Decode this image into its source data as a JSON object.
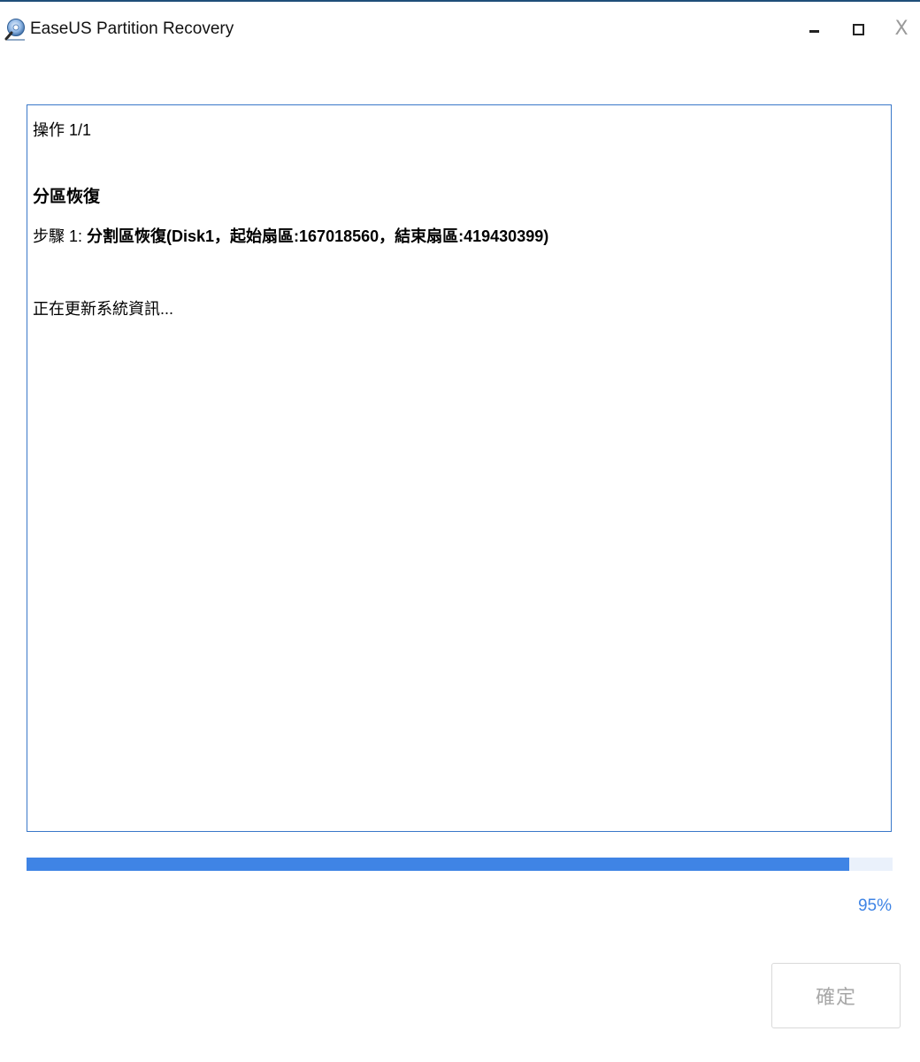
{
  "window": {
    "title": "EaseUS Partition Recovery",
    "minimize_icon": "minimize-icon",
    "maximize_icon": "maximize-icon",
    "close_icon": "close-icon",
    "close_glyph": "X"
  },
  "log": {
    "operation_count": "操作 1/1",
    "section_title": "分區恢復",
    "step_prefix": "步驟 1: ",
    "step_detail": "分割區恢復(Disk1，起始扇區:167018560，結束扇區:419430399)",
    "status": "正在更新系統資訊..."
  },
  "progress": {
    "value": 0.95,
    "label": "95%",
    "fill_color": "#3f84e5",
    "track_color": "#eaf1fb"
  },
  "actions": {
    "ok_label": "確定",
    "ok_enabled": false
  },
  "colors": {
    "accent": "#3f84e5",
    "panel_border": "#3a78c9"
  }
}
